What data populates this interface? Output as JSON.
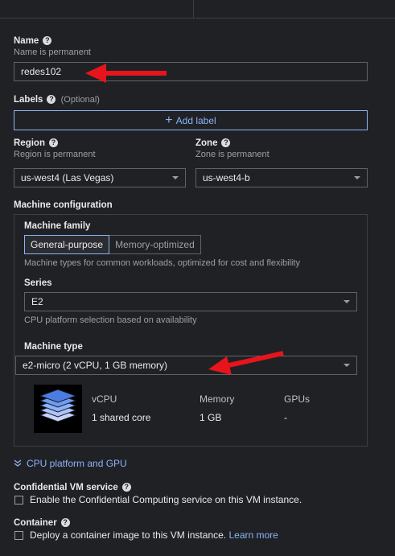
{
  "name": {
    "label": "Name",
    "hint": "Name is permanent",
    "value": "redes102"
  },
  "labels": {
    "label": "Labels",
    "optional": "(Optional)",
    "add_label": "Add label"
  },
  "region": {
    "label": "Region",
    "hint": "Region is permanent",
    "value": "us-west4 (Las Vegas)"
  },
  "zone": {
    "label": "Zone",
    "hint": "Zone is permanent",
    "value": "us-west4-b"
  },
  "machine_config": {
    "title": "Machine configuration",
    "family_label": "Machine family",
    "tabs": [
      "General-purpose",
      "Memory-optimized"
    ],
    "family_desc": "Machine types for common workloads, optimized for cost and flexibility",
    "series_label": "Series",
    "series_value": "E2",
    "series_desc": "CPU platform selection based on availability",
    "type_label": "Machine type",
    "type_value": "e2-micro (2 vCPU, 1 GB memory)",
    "specs": {
      "headers": [
        "vCPU",
        "Memory",
        "GPUs"
      ],
      "values": [
        "1 shared core",
        "1 GB",
        "-"
      ]
    }
  },
  "cpu_platform_link": "CPU platform and GPU",
  "confidential": {
    "label": "Confidential VM service",
    "checkbox_text": "Enable the Confidential Computing service on this VM instance."
  },
  "container": {
    "label": "Container",
    "checkbox_text": "Deploy a container image to this VM instance.",
    "learn_more": "Learn more"
  },
  "colors": {
    "accent": "#8ab4f8",
    "annotation_arrow": "#e8141c",
    "background": "#202124"
  },
  "icons": {
    "help": "help-circle-icon",
    "caret": "caret-down-icon",
    "chip": "layers-stack-icon",
    "expand": "double-chevron-down-icon"
  }
}
